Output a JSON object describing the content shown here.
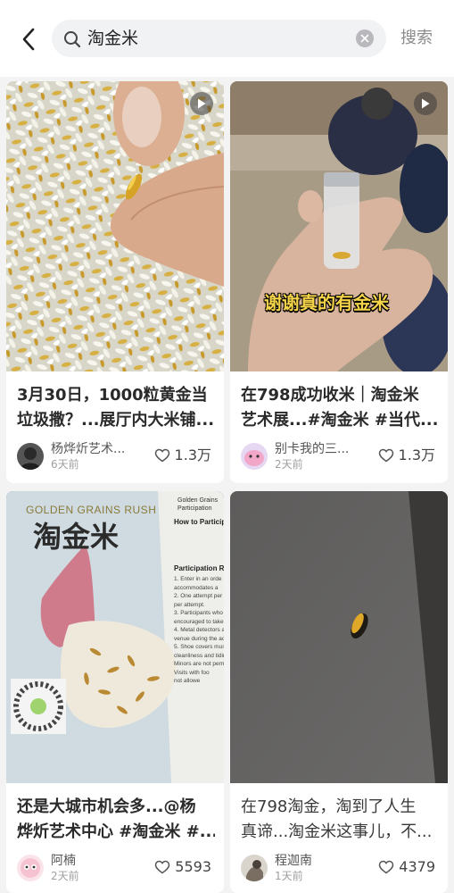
{
  "search": {
    "query": "淘金米",
    "button_label": "搜索"
  },
  "posts": [
    {
      "title_line1": "3月30日，1000粒黄金当",
      "title_line2": "垃圾撒？...展厅内大米铺...",
      "author": "杨烨炘艺术...",
      "time": "6天前",
      "likes": "1.3万",
      "is_video": true
    },
    {
      "title_line1": "在798成功收米｜淘金米",
      "title_line2": "艺术展...#淘金米 #当代...",
      "author": "别卡我的三...",
      "time": "2天前",
      "likes": "1.3万",
      "is_video": true,
      "overlay_text": "谢谢真的有金米"
    },
    {
      "title_line1": "还是大城市机会多...@杨",
      "title_line2": "烨炘艺术中心 #淘金米 #...",
      "author": "阿楠",
      "time": "2天前",
      "likes": "5593",
      "poster_heading": "GOLDEN GRAINS RUSH",
      "poster_title": "淘金米",
      "poster_side_heading": "Golden Grains Participation",
      "poster_side_subheading": "How to Particip",
      "poster_section": "Participation Ru",
      "poster_rules": [
        "1. Enter in an orde",
        "accommodates a",
        "2. One attempt per",
        "per attempt.",
        "3. Participants who",
        "encouraged to take",
        "4. Metal detectors a",
        "venue during the ac",
        "5. Shoe covers must",
        "cleanliness and tidine",
        "Minors are not perm",
        "Visits with foo",
        "not allowe"
      ]
    },
    {
      "title_line1": "在798淘金，淘到了人生",
      "title_line2": "真谛...淘金米这事儿，不...",
      "author": "程迦南",
      "time": "1天前",
      "likes": "4379"
    }
  ],
  "colors": {
    "background": "#f3f3f3",
    "card": "#ffffff",
    "search_field": "#f1f2f4",
    "overlay_text": "#f5d44a"
  }
}
